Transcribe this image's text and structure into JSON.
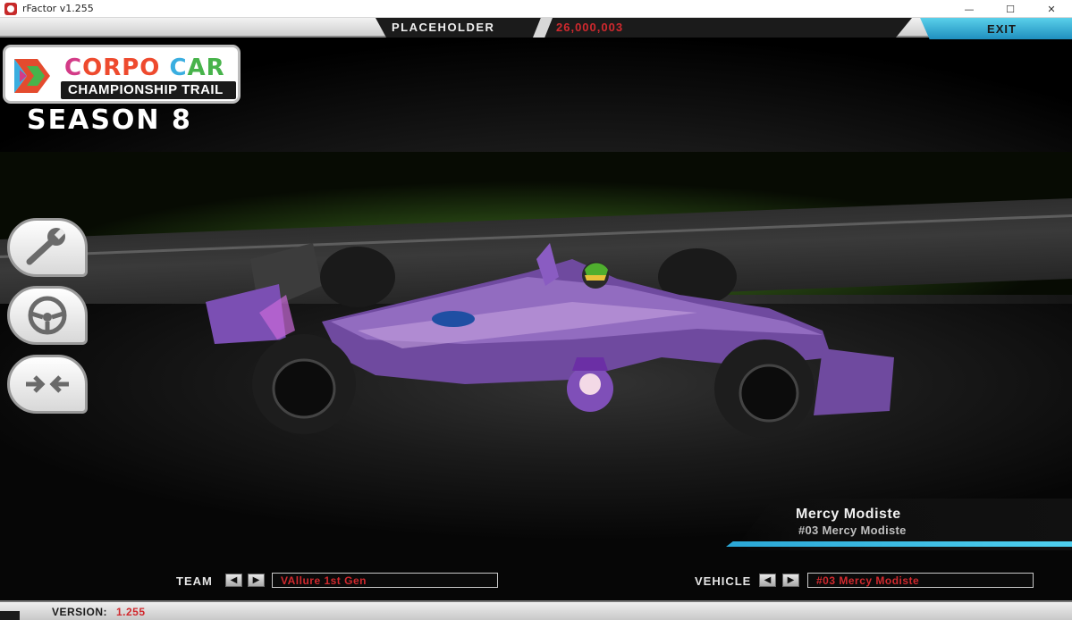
{
  "window": {
    "title": "rFactor v1.255",
    "minimize": "—",
    "maximize": "☐",
    "close": "✕"
  },
  "topbar": {
    "profile_name": "PLACEHOLDER",
    "money": "26,000,003",
    "exit_label": "EXIT"
  },
  "logo": {
    "word1_a": "C",
    "word1_b": "ORPO ",
    "word2_a": "C",
    "word2_b": "AR",
    "line2": "CHAMPIONSHIP TRAIL"
  },
  "season": "SEASON 8",
  "side_buttons": [
    {
      "icon": "wrench-icon"
    },
    {
      "icon": "steering-wheel-icon"
    },
    {
      "icon": "compare-arrows-icon"
    }
  ],
  "driver": {
    "name": "Mercy Modiste",
    "entry": "#03 Mercy Modiste"
  },
  "team": {
    "label": "TEAM",
    "value": "VAllure 1st Gen"
  },
  "vehicle": {
    "label": "VEHICLE",
    "value": "#03 Mercy Modiste"
  },
  "nav": {
    "prev": "◀",
    "next": "▶"
  },
  "version": {
    "label": "VERSION:",
    "value": "1.255"
  },
  "colors": {
    "accent_blue": "#2aa7d6",
    "money_red": "#d1292e",
    "car_purple": "#8a5cc2"
  }
}
